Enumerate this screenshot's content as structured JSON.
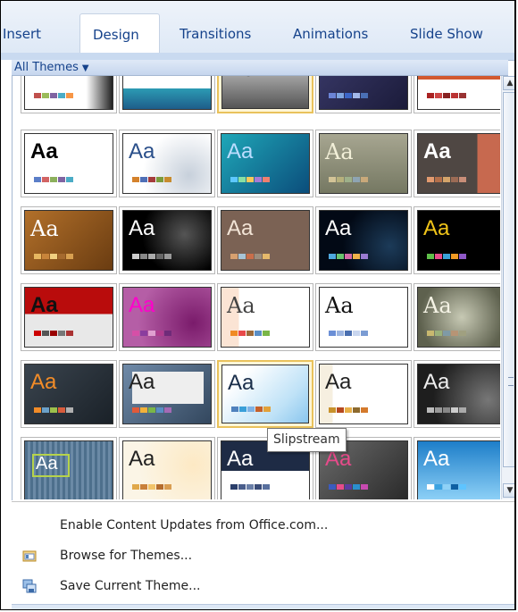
{
  "tabs": [
    {
      "label": "Insert",
      "active": false
    },
    {
      "label": "Design",
      "active": true
    },
    {
      "label": "Transitions",
      "active": false
    },
    {
      "label": "Animations",
      "active": false
    },
    {
      "label": "Slide Show",
      "active": false
    }
  ],
  "gallery": {
    "header": "All Themes",
    "themes_label": "Aa",
    "tooltip": "Slipstream"
  },
  "menu": {
    "items": [
      {
        "label": "Enable Content Updates from Office.com...",
        "icon": "none"
      },
      {
        "label": "Browse for Themes...",
        "icon": "folder-icon"
      },
      {
        "label": "Save Current Theme...",
        "icon": "save-theme-icon"
      }
    ]
  },
  "colors": {
    "ribbon_text": "#15428b",
    "selection": "#e9c25c"
  }
}
